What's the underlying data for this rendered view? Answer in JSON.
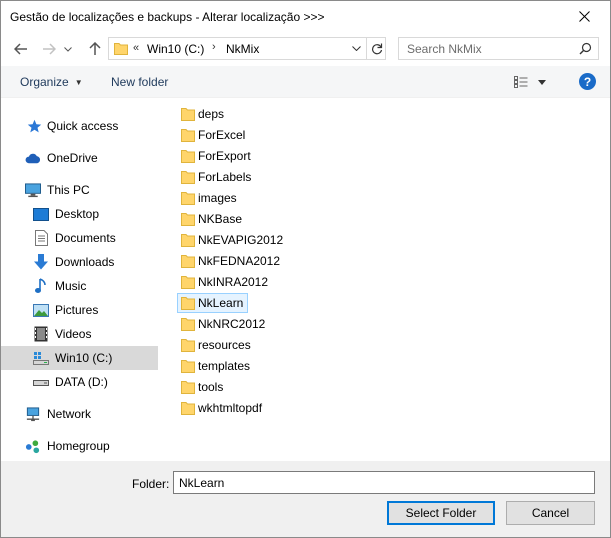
{
  "window": {
    "title": "Gestão de localizações e backups - Alterar localização >>>"
  },
  "navbar": {
    "address": {
      "overflow_chevron": "«",
      "crumbs": [
        "Win10 (C:)",
        "NkMix"
      ],
      "separator": "›"
    },
    "search": {
      "placeholder": "Search NkMix"
    }
  },
  "cmdbar": {
    "organize_label": "Organize",
    "new_folder_label": "New folder",
    "help_label": "?"
  },
  "navpane": {
    "items": [
      {
        "label": "Quick access",
        "icon": "star-icon"
      },
      {
        "label": "OneDrive",
        "icon": "cloud-icon"
      },
      {
        "label": "This PC",
        "icon": "computer-icon"
      },
      {
        "label": "Desktop",
        "icon": "desktop-icon"
      },
      {
        "label": "Documents",
        "icon": "document-icon"
      },
      {
        "label": "Downloads",
        "icon": "download-icon"
      },
      {
        "label": "Music",
        "icon": "music-icon"
      },
      {
        "label": "Pictures",
        "icon": "pictures-icon"
      },
      {
        "label": "Videos",
        "icon": "video-icon"
      },
      {
        "label": "Win10 (C:)",
        "icon": "drive-icon",
        "selected": true
      },
      {
        "label": "DATA (D:)",
        "icon": "drive-icon"
      },
      {
        "label": "Network",
        "icon": "network-icon"
      },
      {
        "label": "Homegroup",
        "icon": "homegroup-icon"
      }
    ]
  },
  "content": {
    "folders": [
      "deps",
      "ForExcel",
      "ForExport",
      "ForLabels",
      "images",
      "NKBase",
      "NkEVAPIG2012",
      "NkFEDNA2012",
      "NkINRA2012",
      "NkLearn",
      "NkNRC2012",
      "resources",
      "templates",
      "tools",
      "wkhtmltopdf"
    ],
    "selected": "NkLearn"
  },
  "footer": {
    "folder_label": "Folder:",
    "folder_value": "NkLearn",
    "select_button": "Select Folder",
    "cancel_button": "Cancel"
  },
  "colors": {
    "accent": "#0078d7",
    "folder": "#ffd56b",
    "selection_bg": "#e5f3ff",
    "selection_border": "#99d1ff",
    "nav_selected": "#d9d9d9",
    "footer_bg": "#f0f0f0"
  }
}
